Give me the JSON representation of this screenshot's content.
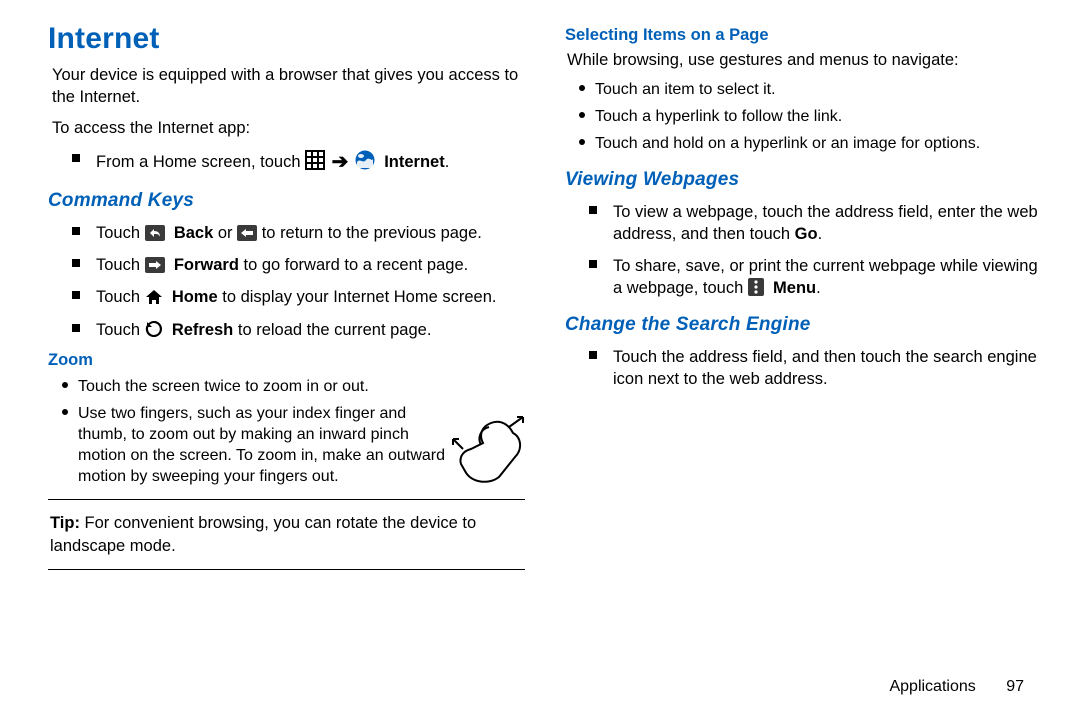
{
  "title": "Internet",
  "intro": "Your device is equipped with a browser that gives you access to the Internet.",
  "accessLabel": "To access the Internet app:",
  "fromHome_pre": "From a Home screen, touch ",
  "fromHome_app": "Internet",
  "commandKeys": {
    "heading": "Command Keys",
    "back": {
      "pre": "Touch ",
      "label": "Back",
      "mid": " or ",
      "post": " to return to the previous page."
    },
    "forward": {
      "pre": "Touch ",
      "label": "Forward",
      "post": " to go forward to a recent page."
    },
    "home": {
      "pre": "Touch ",
      "label": "Home",
      "post": " to display your Internet Home screen."
    },
    "refresh": {
      "pre": "Touch ",
      "label": "Refresh",
      "post": " to reload the current page."
    }
  },
  "zoom": {
    "heading": "Zoom",
    "items": [
      "Touch the screen twice to zoom in or out.",
      "Use two fingers, such as your index finger and thumb, to zoom out by making an inward pinch motion on the screen. To zoom in, make an outward motion by sweeping your fingers out."
    ]
  },
  "tip": {
    "label": "Tip:",
    "text": " For convenient browsing, you can rotate the device to landscape mode."
  },
  "selecting": {
    "heading": "Selecting Items on a Page",
    "intro": "While browsing, use gestures and menus to navigate:",
    "items": [
      "Touch an item to select it.",
      "Touch a hyperlink to follow the link.",
      "Touch and hold on a hyperlink or an image for options."
    ]
  },
  "viewing": {
    "heading": "Viewing Webpages",
    "item1": "To view a webpage, touch the address field, enter the web address, and then touch ",
    "item1_go": "Go",
    "item1_end": ".",
    "item2_pre": "To share, save, or print the current webpage while viewing a webpage, touch ",
    "item2_menu": "Menu",
    "item2_end": "."
  },
  "changeEngine": {
    "heading": "Change the Search Engine",
    "item": "Touch the address field, and then touch the search engine icon next to the web address."
  },
  "footer": {
    "section": "Applications",
    "page": "97"
  }
}
